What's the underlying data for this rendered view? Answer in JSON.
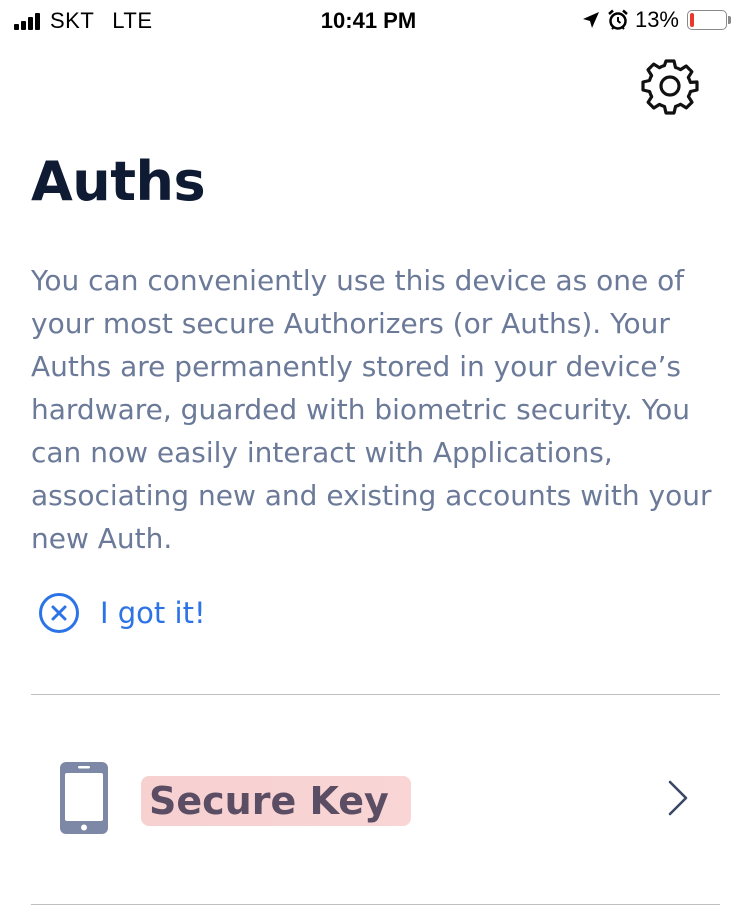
{
  "status_bar": {
    "carrier": "SKT",
    "network": "LTE",
    "time": "10:41 PM",
    "battery_percent": "13%",
    "battery_level": 0.13,
    "battery_color": "#e8392a"
  },
  "header": {
    "settings_icon": "gear-icon",
    "title": "Auths"
  },
  "intro": {
    "text": "You can conveniently use this device as one of your most secure Authorizers (or Auths). Your Auths are permanently stored in your device’s hardware, guarded with biometric security. You can now easily interact with Applications, associating new and existing accounts with your new Auth."
  },
  "dismiss": {
    "icon": "close-circle-icon",
    "label": "I got it!",
    "color": "#2b73e6"
  },
  "auths": [
    {
      "icon": "phone-icon",
      "label": "Secure Key",
      "chevron": "chevron-right-icon"
    }
  ]
}
